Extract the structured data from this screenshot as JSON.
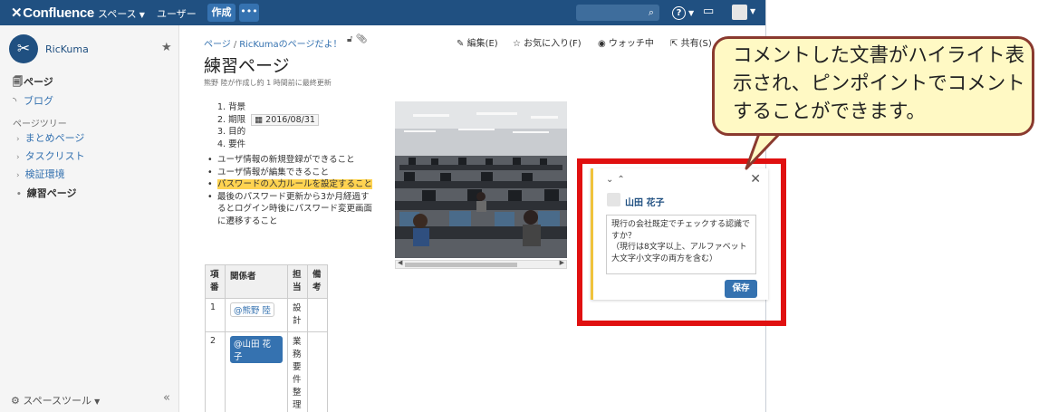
{
  "topbar": {
    "logo_text": "Confluence",
    "nav_spaces": "スペース",
    "nav_people": "ユーザー",
    "create_label": "作成",
    "more_label": "•••",
    "help_icon": "?"
  },
  "sidebar": {
    "space_name": "RicKuma",
    "pages_label": "ページ",
    "blog_label": "ブログ",
    "tree_heading": "ページツリー",
    "tree": [
      {
        "label": "まとめページ"
      },
      {
        "label": "タスクリスト"
      },
      {
        "label": "検証環境"
      },
      {
        "label": "練習ページ"
      }
    ],
    "space_tools": "スペースツール"
  },
  "page": {
    "breadcrumb": [
      "ページ",
      "RicKumaのページだよ！"
    ],
    "actions": {
      "edit": "編集(E)",
      "favorite": "お気に入り(F)",
      "watch": "ウォッチ中",
      "share": "共有(S)"
    },
    "title": "練習ページ",
    "byline": "熊野 陸が作成し約 1 時間前に最終更新",
    "ordered_list": [
      "背景",
      "期限",
      "目的",
      "要件"
    ],
    "deadline_date": "2016/08/31",
    "bullets": [
      "ユーザ情報の新規登録ができること",
      "ユーザ情報が編集できること",
      "パスワードの入力ルールを設定すること",
      "最後のパスワード更新から3か月経過するとログイン時後にパスワード変更画面に遷移すること"
    ],
    "table": {
      "headers": [
        "項番",
        "関係者",
        "担当",
        "備考"
      ],
      "rows": [
        {
          "no": "1",
          "person": "@熊野 陸",
          "role": "設計",
          "note": ""
        },
        {
          "no": "2",
          "person": "@山田 花子",
          "role": "業務要件整理",
          "note": ""
        }
      ]
    }
  },
  "comment": {
    "user": "山田 花子",
    "text": "現行の会社既定でチェックする認識ですか？\n（現行は8文字以上、アルファベット大文字小文字の両方を含む）",
    "save_label": "保存"
  },
  "callout": {
    "text": "コメントした文書がハイライト表示され、ピンポイントでコメントすることができます。"
  },
  "colors": {
    "topbar": "#205081",
    "link": "#3572b0",
    "highlight": "#ffd351",
    "red_frame": "#e01010",
    "callout_fill": "#fff9c4",
    "callout_border": "#8a3a2f"
  }
}
